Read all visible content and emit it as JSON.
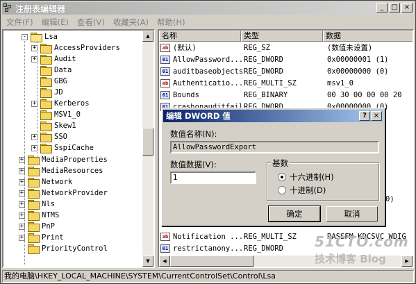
{
  "window": {
    "title": "注册表编辑器",
    "buttons": {
      "minimize": "_",
      "maximize": "□",
      "close": "×"
    }
  },
  "menu": [
    "文件(F)",
    "编辑(E)",
    "查看(V)",
    "收藏夹(A)",
    "帮助(H)"
  ],
  "tree": {
    "items": [
      {
        "label": "Lsa",
        "expander": "-",
        "open": true
      },
      {
        "label": "AccessProviders",
        "expander": "+"
      },
      {
        "label": "Audit",
        "expander": "+"
      },
      {
        "label": "Data",
        "expander": ""
      },
      {
        "label": "GBG",
        "expander": ""
      },
      {
        "label": "JD",
        "expander": ""
      },
      {
        "label": "Kerberos",
        "expander": "+"
      },
      {
        "label": "MSV1_0",
        "expander": ""
      },
      {
        "label": "Skew1",
        "expander": ""
      },
      {
        "label": "SSO",
        "expander": "+"
      },
      {
        "label": "SspiCache",
        "expander": "+"
      },
      {
        "label": "MediaProperties",
        "expander": "+"
      },
      {
        "label": "MediaResources",
        "expander": "+"
      },
      {
        "label": "Network",
        "expander": "+"
      },
      {
        "label": "NetworkProvider",
        "expander": "+"
      },
      {
        "label": "Nls",
        "expander": "+"
      },
      {
        "label": "NTMS",
        "expander": "+"
      },
      {
        "label": "PnP",
        "expander": "+"
      },
      {
        "label": "Print",
        "expander": "+"
      },
      {
        "label": "PriorityControl",
        "expander": ""
      }
    ]
  },
  "list": {
    "columns": [
      "名称",
      "类型",
      "数据"
    ],
    "rows": [
      {
        "icon": "ab",
        "name": "(默认)",
        "type": "REG_SZ",
        "data": "(数值未设置)"
      },
      {
        "icon": "bin",
        "name": "AllowPassword...",
        "type": "REG_DWORD",
        "data": "0x00000001 (1)"
      },
      {
        "icon": "bin",
        "name": "auditbaseobjects",
        "type": "REG_DWORD",
        "data": "0x00000000 (0)"
      },
      {
        "icon": "ab",
        "name": "Authenticatio...",
        "type": "REG_MULTI_SZ",
        "data": "msv1_0"
      },
      {
        "icon": "bin",
        "name": "Bounds",
        "type": "REG_BINARY",
        "data": "00 30 00 00 00 20"
      },
      {
        "icon": "bin",
        "name": "crashonauditfail",
        "type": "REG_DWORD",
        "data": "0x00000000 (0)"
      },
      {
        "icon": "ab",
        "name": "Notification ...",
        "type": "REG_MULTI_SZ",
        "data": "RASSFM KDCSVC WDIG"
      },
      {
        "icon": "bin",
        "name": "restrictanony...",
        "type": "REG_DWORD",
        "data": ""
      }
    ],
    "partial_data": "0)"
  },
  "dialog": {
    "title": "编辑 DWORD 值",
    "help": "?",
    "close": "×",
    "name_label": "数值名称(N):",
    "name_value": "AllowPasswordExport",
    "data_label": "数值数据(V):",
    "data_value": "1",
    "base_label": "基数",
    "radio_hex": "十六进制(H)",
    "radio_dec": "十进制(D)",
    "ok": "确定",
    "cancel": "取消"
  },
  "status": "我的电脑\\HKEY_LOCAL_MACHINE\\SYSTEM\\CurrentControlSet\\Control\\Lsa",
  "watermark": {
    "main": "51CTO.com",
    "sub": "技术博客 Blog"
  }
}
